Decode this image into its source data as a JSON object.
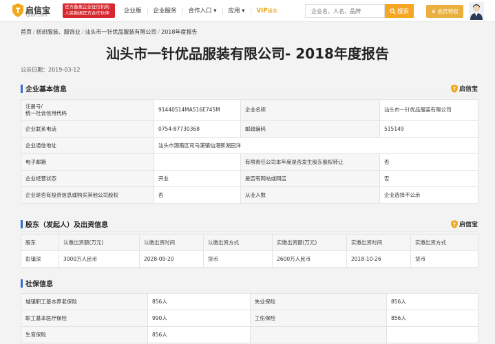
{
  "header": {
    "logo_cn": "启信宝",
    "logo_en": "Qixin.com",
    "gov_badge_line1": "官方备案企业征信机构",
    "gov_badge_line2": "人民数据官方合作伙伴",
    "nav": [
      "企业版",
      "企业服务",
      "合作入口",
      "应用"
    ],
    "vip_label": "VIP",
    "vip_sub": "服务",
    "search_placeholder": "企业名、人名、品牌",
    "search_button": "搜索",
    "member_button": "会员特权"
  },
  "breadcrumb": [
    "首页",
    "纺织服装、服饰业",
    "汕头市一针优品服装有限公司",
    "2018年度报告"
  ],
  "page_title": "汕头市一针优品服装有限公司- 2018年度报告",
  "pub_date": "公示日期：2019-03-12",
  "brand_mark": "启信宝",
  "basic": {
    "title": "企业基本信息",
    "rows": [
      [
        "注册号/\n统一社会信用代码",
        "91440514MA516E745M",
        "企业名称",
        "汕头市一针优品服装有限公司"
      ],
      [
        "企业联系电话",
        "0754-87730368",
        "邮政编码",
        "515149"
      ],
      [
        "企业通信地址",
        "汕头市潮南区司马浦镇仙港新湖田洋",
        "",
        ""
      ],
      [
        "电子邮箱",
        "",
        "有限责任公司本年度是否发生股东股权转让",
        "否"
      ],
      [
        "企业经营状态",
        "开业",
        "是否有网站或网店",
        "否"
      ],
      [
        "企业是否有投资信息或购买其他公司股权",
        "否",
        "从业人数",
        "企业选择不公示"
      ]
    ]
  },
  "shareholders": {
    "title": "股东（发起人）及出资信息",
    "headers": [
      "股东",
      "认缴出资额(万元)",
      "认缴出资时间",
      "认缴出资方式",
      "实缴出资额(万元)",
      "实缴出资时间",
      "实缴出资方式"
    ],
    "rows": [
      [
        "彭镇深",
        "3000万人民币",
        "2028-09-20",
        "货币",
        "2600万人民币",
        "2018-10-26",
        "货币"
      ]
    ]
  },
  "social": {
    "title": "社保信息",
    "rows": [
      [
        "城镇职工基本养老保险",
        "856人",
        "失业保险",
        "856人"
      ],
      [
        "职工基本医疗保险",
        "990人",
        "工伤保险",
        "856人"
      ],
      [
        "生育保险",
        "856人",
        "",
        ""
      ]
    ]
  }
}
